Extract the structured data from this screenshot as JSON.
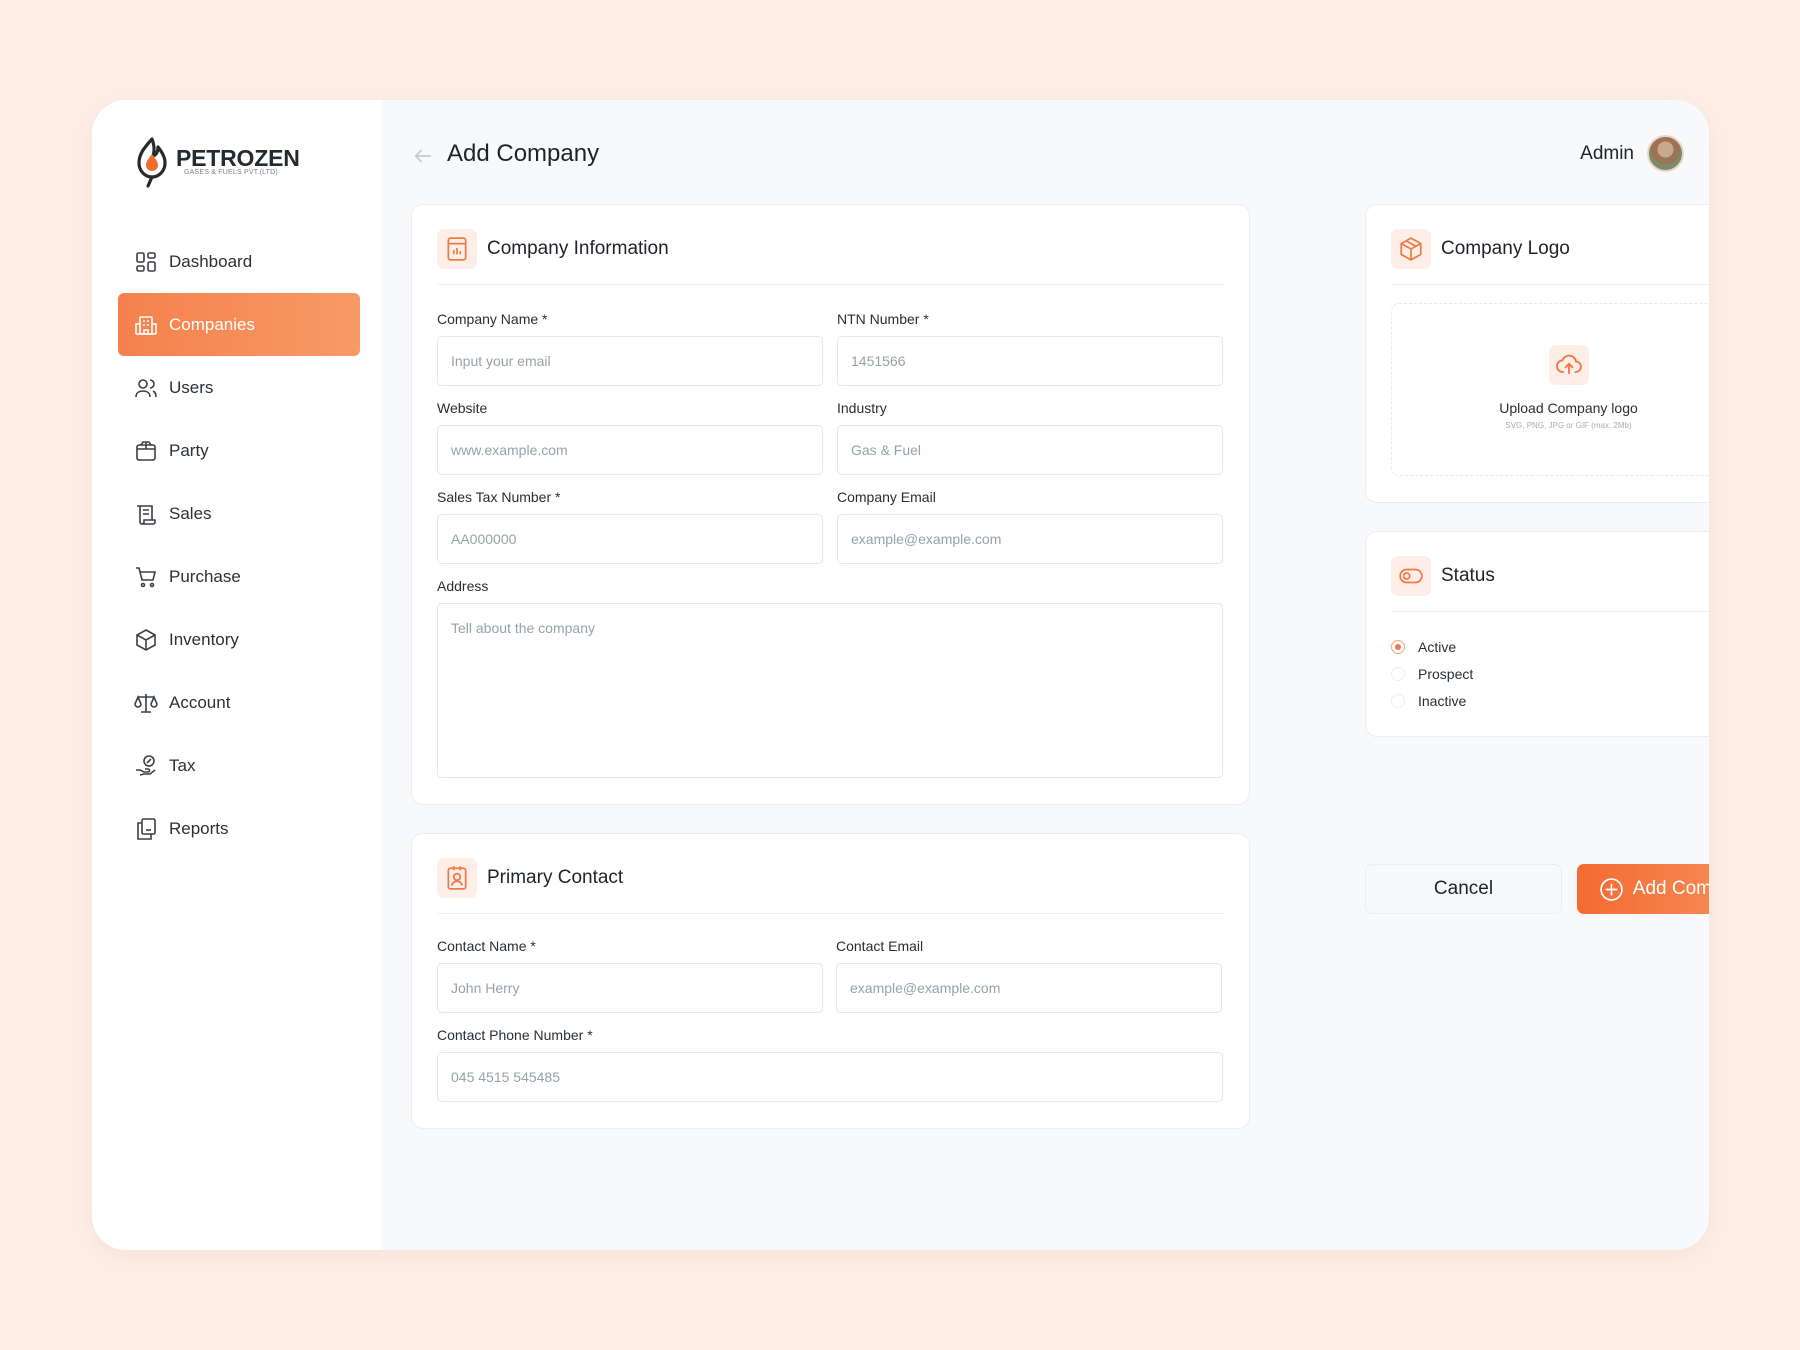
{
  "brand": {
    "name": "PETROZEN",
    "subtitle": "GASES & FUELS PVT.(LTD)",
    "accent": "#f4814d"
  },
  "sidebar": {
    "items": [
      {
        "label": "Dashboard",
        "icon": "dashboard-icon",
        "active": false
      },
      {
        "label": "Companies",
        "icon": "building-icon",
        "active": true
      },
      {
        "label": "Users",
        "icon": "users-icon",
        "active": false
      },
      {
        "label": "Party",
        "icon": "party-icon",
        "active": false
      },
      {
        "label": "Sales",
        "icon": "receipt-icon",
        "active": false
      },
      {
        "label": "Purchase",
        "icon": "cart-icon",
        "active": false
      },
      {
        "label": "Inventory",
        "icon": "box-icon",
        "active": false
      },
      {
        "label": "Account",
        "icon": "scale-icon",
        "active": false
      },
      {
        "label": "Tax",
        "icon": "tax-hand-icon",
        "active": false
      },
      {
        "label": "Reports",
        "icon": "reports-icon",
        "active": false
      }
    ]
  },
  "header": {
    "title": "Add Company",
    "user": "Admin"
  },
  "company_info": {
    "title": "Company Information",
    "company_name": {
      "label": "Company Name *",
      "placeholder": "Input your email"
    },
    "ntn_number": {
      "label": "NTN Number *",
      "placeholder": "1451566"
    },
    "website": {
      "label": "Website",
      "placeholder": "www.example.com"
    },
    "industry": {
      "label": "Industry",
      "placeholder": "Gas & Fuel"
    },
    "sales_tax": {
      "label": "Sales Tax Number *",
      "placeholder": "AA000000"
    },
    "company_email": {
      "label": "Company Email",
      "placeholder": "example@example.com"
    },
    "address": {
      "label": "Address",
      "placeholder": "Tell about the company"
    }
  },
  "primary_contact": {
    "title": "Primary Contact",
    "contact_name": {
      "label": "Contact Name *",
      "placeholder": "John Herry"
    },
    "contact_email": {
      "label": "Contact Email",
      "placeholder": "example@example.com"
    },
    "contact_phone": {
      "label": "Contact Phone Number *",
      "placeholder": "045 4515 545485"
    }
  },
  "company_logo": {
    "title": "Company Logo",
    "upload_title": "Upload Company logo",
    "upload_hint": "SVG, PNG, JPG or GIF (max. 2Mb)"
  },
  "status": {
    "title": "Status",
    "options": [
      {
        "label": "Active",
        "selected": true
      },
      {
        "label": "Prospect",
        "selected": false
      },
      {
        "label": "Inactive",
        "selected": false
      }
    ]
  },
  "actions": {
    "cancel": "Cancel",
    "submit": "Add Company"
  }
}
